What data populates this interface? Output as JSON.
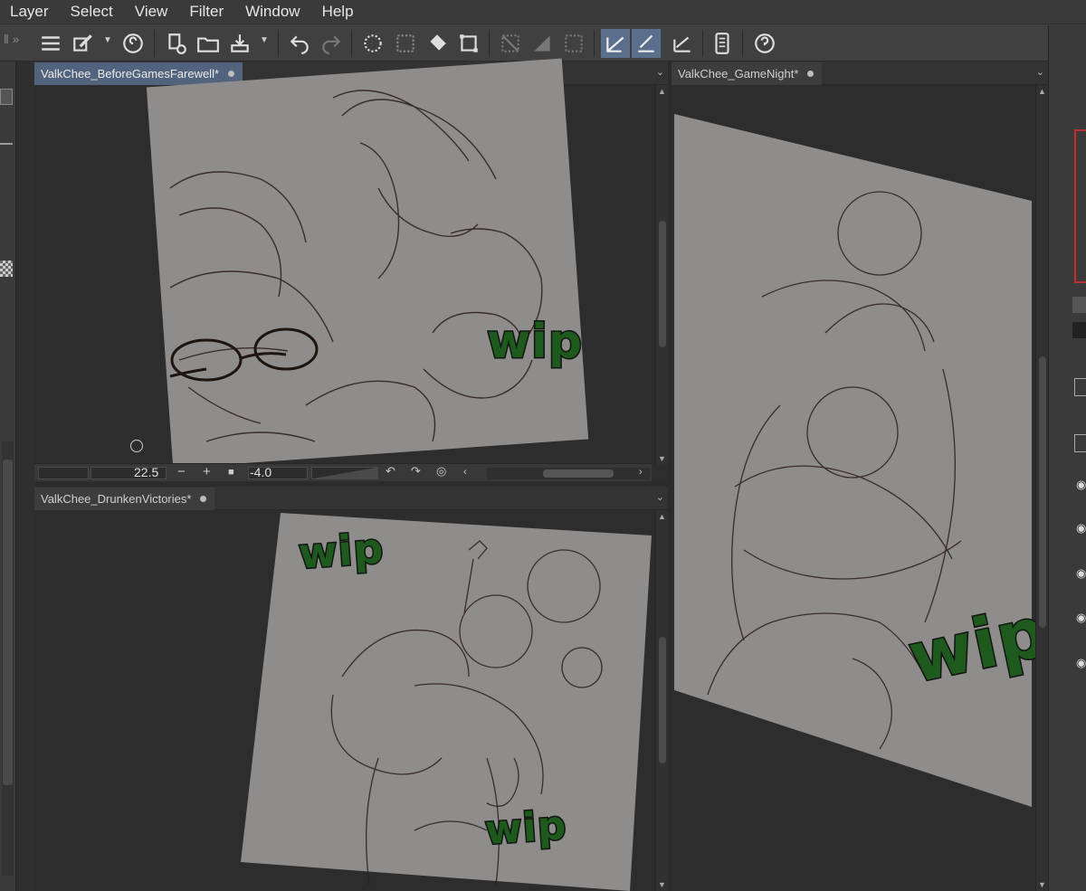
{
  "menu": [
    "Layer",
    "Select",
    "View",
    "Filter",
    "Window",
    "Help"
  ],
  "toolbar_icons": [
    "menu-icon",
    "brush-settings-icon",
    "spiral-icon",
    "new-file-icon",
    "open-folder-icon",
    "save-icon",
    "undo-icon",
    "redo-icon",
    "selection-dots-icon",
    "select-icon",
    "fill-icon",
    "transform-icon",
    "hide-selection-icon",
    "fill-pattern-icon",
    "snap-icon",
    "ruler-snap-icon",
    "special-ruler-icon",
    "perspective-icon",
    "smartphone-icon",
    "help-icon"
  ],
  "windows": {
    "before": {
      "tab_label": "ValkChee_BeforeGamesFarewell*",
      "wip": "wip"
    },
    "gamenight": {
      "tab_label": "ValkChee_GameNight*",
      "wip": "wip"
    },
    "drunken": {
      "tab_label": "ValkChee_DrunkenVictories*",
      "wip_top": "wip",
      "wip_bottom": "wip"
    }
  },
  "navigator": {
    "zoom": "22.5",
    "rotate": "-4.0"
  }
}
